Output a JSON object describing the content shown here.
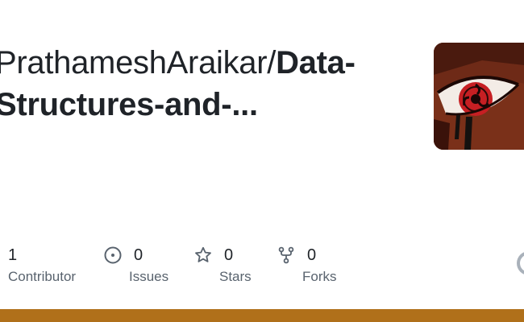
{
  "repo": {
    "owner": "PrathameshAraikar/",
    "name_line1": "Data-",
    "name_line2": "Structures-and-..."
  },
  "stats": [
    {
      "value": "1",
      "label": "Contributor",
      "icon": "people-icon"
    },
    {
      "value": "0",
      "label": "Issues",
      "icon": "issue-circle-icon"
    },
    {
      "value": "0",
      "label": "Stars",
      "icon": "star-icon"
    },
    {
      "value": "0",
      "label": "Forks",
      "icon": "fork-icon"
    }
  ],
  "colors": {
    "accent_bar": "#b0701a",
    "text": "#1f2328",
    "muted": "#59636e",
    "icon": "#59636e"
  }
}
